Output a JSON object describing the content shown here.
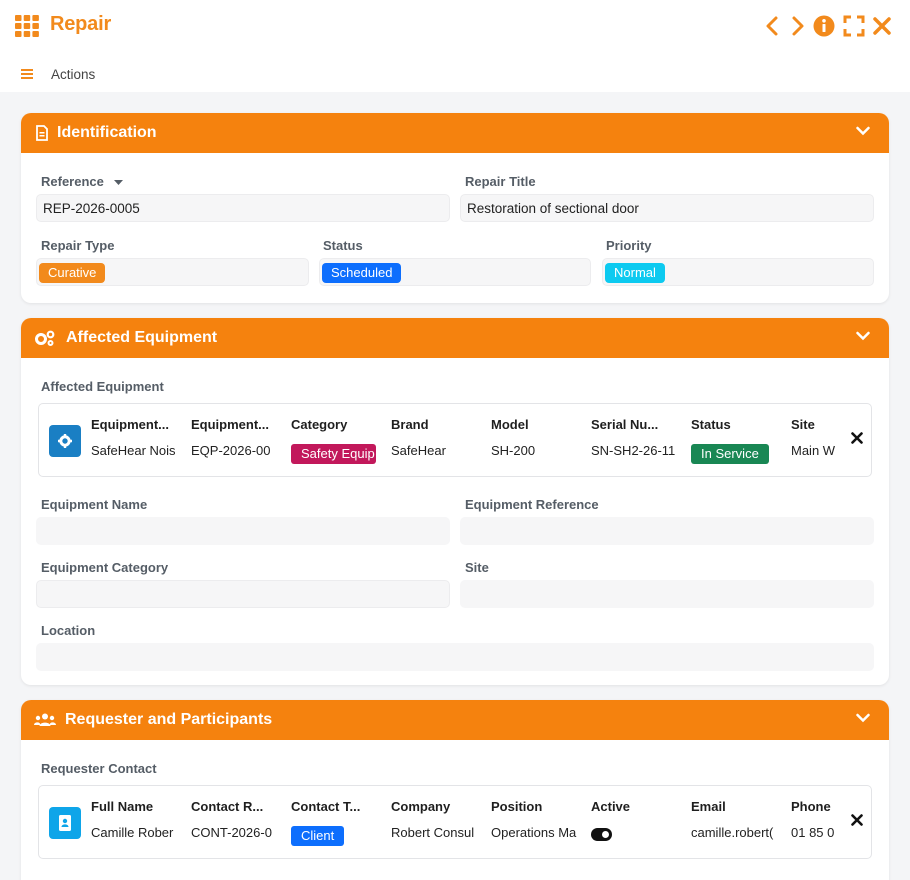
{
  "window": {
    "title": "Repair",
    "actions_label": "Actions",
    "app_icon": "grid-apps-icon",
    "controls": [
      "chevron-left-icon",
      "chevron-right-icon",
      "info-icon",
      "expand-icon",
      "close-icon"
    ]
  },
  "colors": {
    "accent": "#f5820e",
    "curative": "#f28a1c",
    "scheduled": "#0d6efd",
    "normal": "#0dcaf0",
    "safety": "#c2185b",
    "in_service": "#198754",
    "client": "#0d6efd"
  },
  "identification": {
    "title": "Identification",
    "reference_label": "Reference",
    "reference_value": "REP-2026-0005",
    "repair_title_label": "Repair Title",
    "repair_title_value": "Restoration of sectional door",
    "repair_type_label": "Repair Type",
    "repair_type_value": "Curative",
    "status_label": "Status",
    "status_value": "Scheduled",
    "priority_label": "Priority",
    "priority_value": "Normal"
  },
  "equipment": {
    "title": "Affected Equipment",
    "grid_label": "Affected Equipment",
    "columns": [
      "Equipment...",
      "Equipment...",
      "Category",
      "Brand",
      "Model",
      "Serial Nu...",
      "Status",
      "Site"
    ],
    "row": {
      "name": "SafeHear Nois",
      "reference": "EQP-2026-00",
      "category": "Safety Equip",
      "brand": "SafeHear",
      "model": "SH-200",
      "serial": "SN-SH2-26-11",
      "status": "In Service",
      "site": "Main W"
    },
    "equipment_name_label": "Equipment Name",
    "equipment_reference_label": "Equipment Reference",
    "equipment_category_label": "Equipment Category",
    "site_label": "Site",
    "location_label": "Location"
  },
  "requester": {
    "title": "Requester and Participants",
    "grid_label": "Requester Contact",
    "columns": [
      "Full Name",
      "Contact R...",
      "Contact T...",
      "Company",
      "Position",
      "Active",
      "Email",
      "Phone"
    ],
    "row": {
      "full_name": "Camille Rober",
      "contact_ref": "CONT-2026-0",
      "contact_type": "Client",
      "company": "Robert Consul",
      "position": "Operations Ma",
      "active": true,
      "email": "camille.robert(",
      "phone": "01 85 0"
    }
  }
}
